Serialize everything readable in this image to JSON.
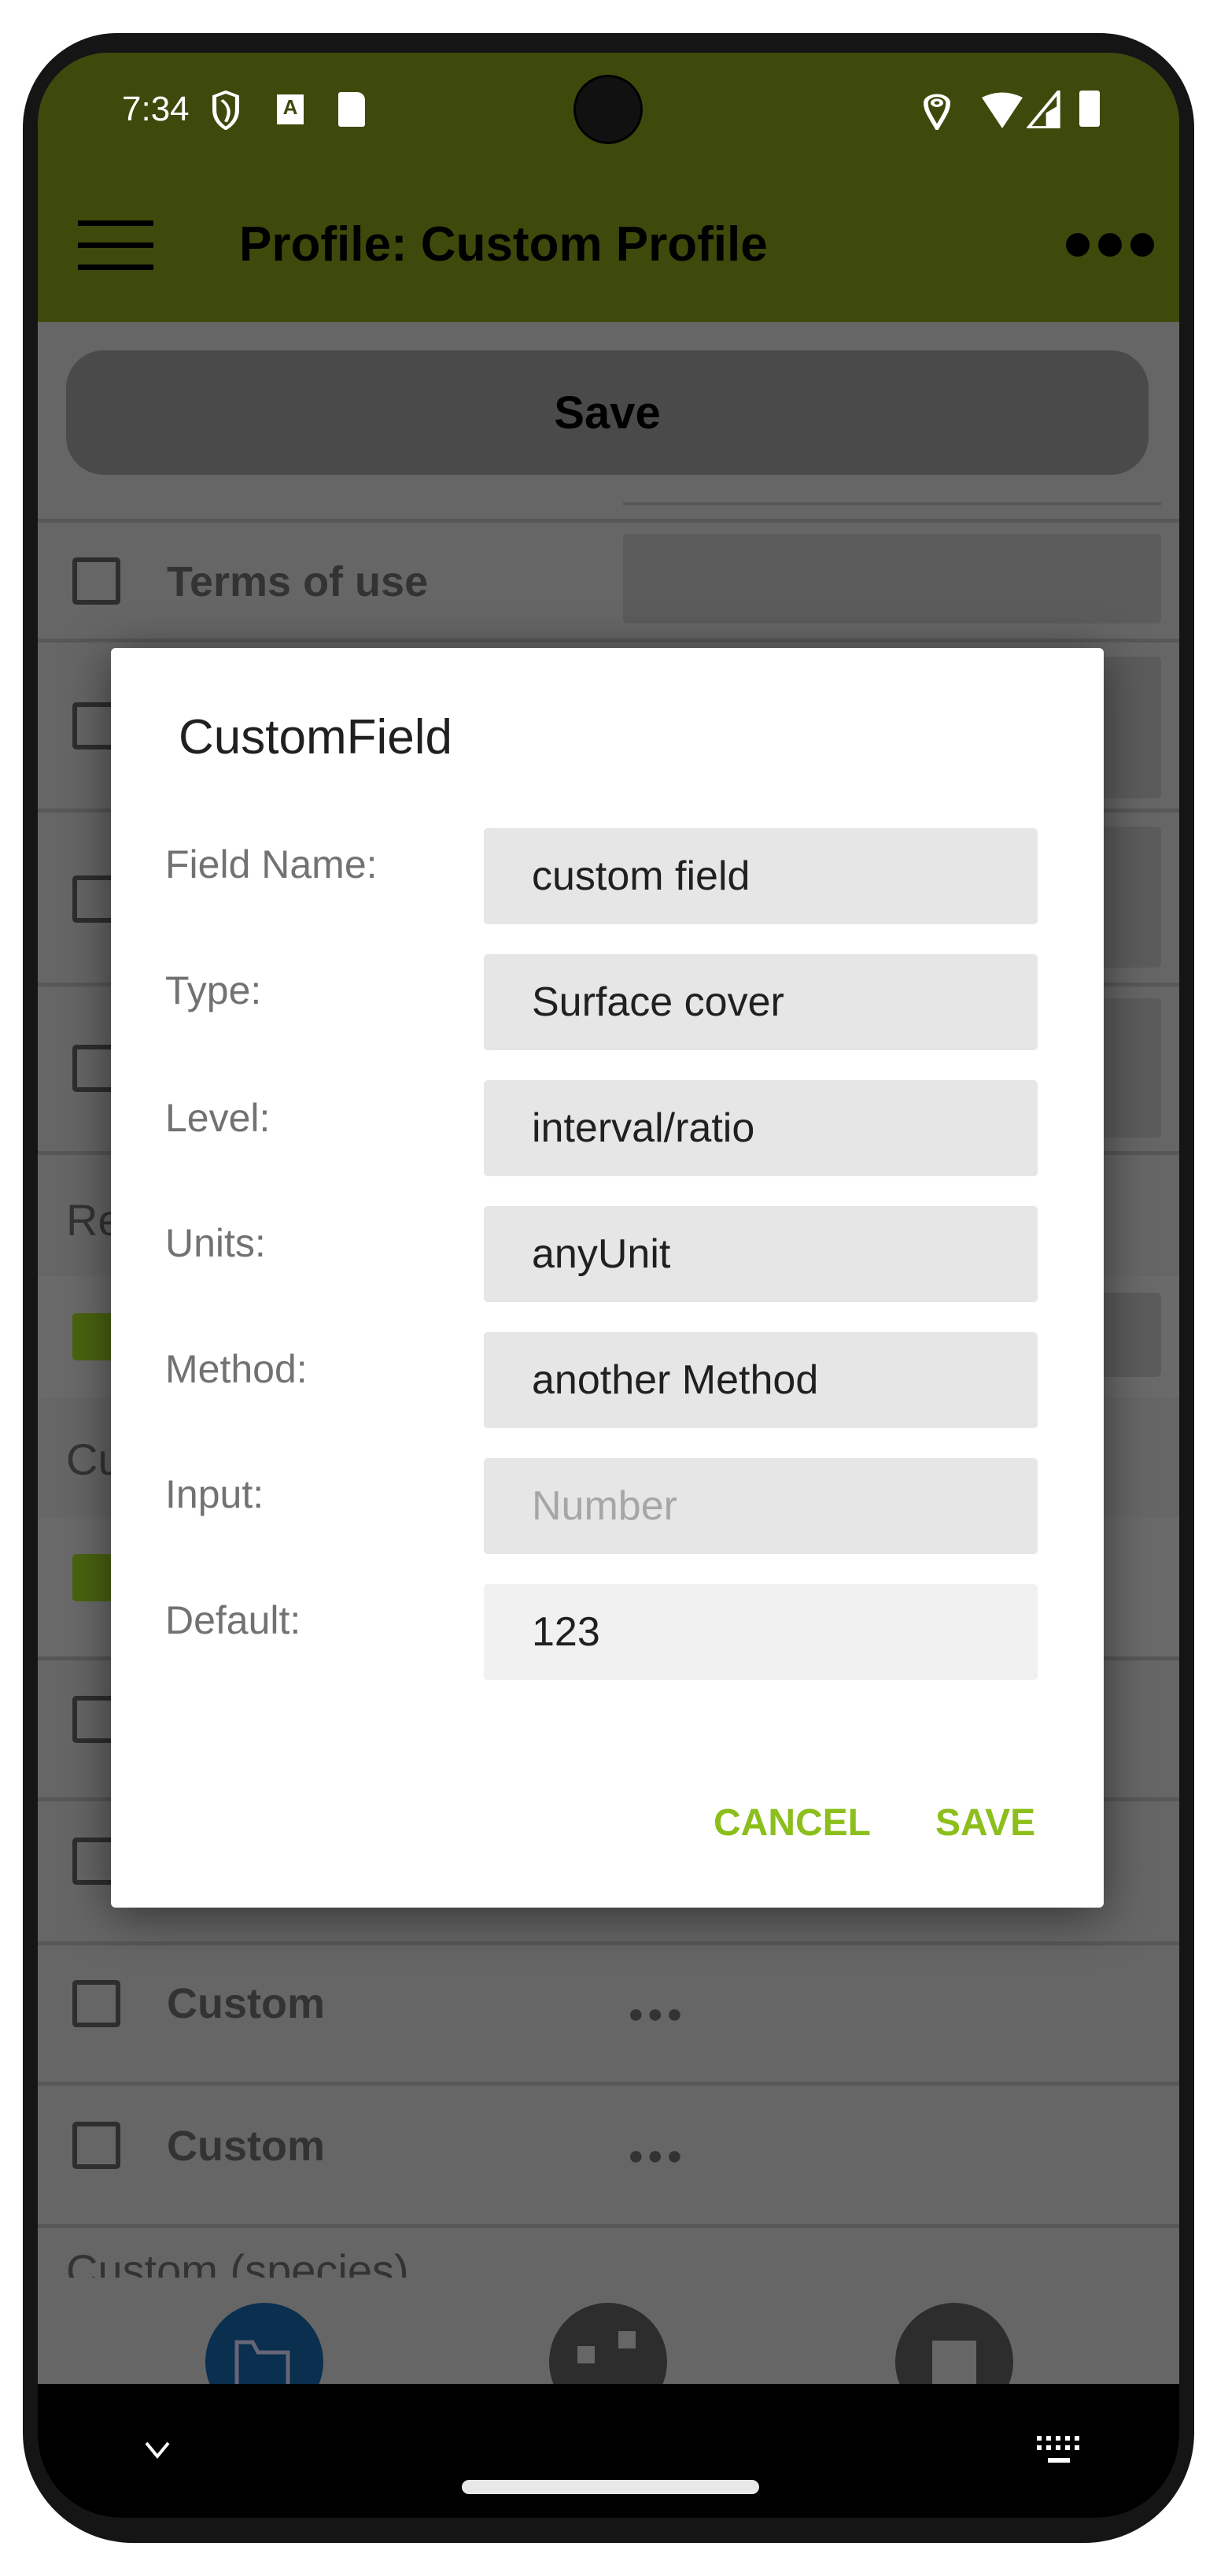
{
  "status_bar": {
    "time": "7:34",
    "icons": [
      "shield-icon",
      "a-badge-icon",
      "sd-card-icon",
      "location-icon",
      "wifi-icon",
      "signal-icon",
      "battery-icon"
    ]
  },
  "app_bar": {
    "title": "Profile: Custom Profile",
    "menu_icon": "hamburger-icon",
    "overflow_icon": "more-horizontal-icon"
  },
  "main": {
    "save_label": "Save",
    "rows": [
      {
        "label": "Terms of use",
        "checked": false
      },
      {
        "label": "",
        "checked": false
      },
      {
        "label": "",
        "checked": false
      },
      {
        "label": "",
        "checked": false
      }
    ],
    "header_1": "Re",
    "header_2": "Cu",
    "custom_rows": [
      {
        "label": "Custom"
      },
      {
        "label": "Custom"
      }
    ],
    "header_3": "Custom (species)"
  },
  "dialog": {
    "title": "CustomField",
    "fields": [
      {
        "label": "Field Name:",
        "value": "custom field"
      },
      {
        "label": "Type:",
        "value": "Surface cover"
      },
      {
        "label": "Level:",
        "value": "interval/ratio"
      },
      {
        "label": "Units:",
        "value": "anyUnit"
      },
      {
        "label": "Method:",
        "value": "another Method"
      },
      {
        "label": "Input:",
        "placeholder": "Number"
      },
      {
        "label": "Default:",
        "value": "123"
      }
    ],
    "cancel_label": "CANCEL",
    "save_label": "SAVE"
  },
  "colors": {
    "app_bar": "#3d4a0c",
    "accent": "#8dbf1c",
    "nav_active": "#0b2f4f"
  }
}
